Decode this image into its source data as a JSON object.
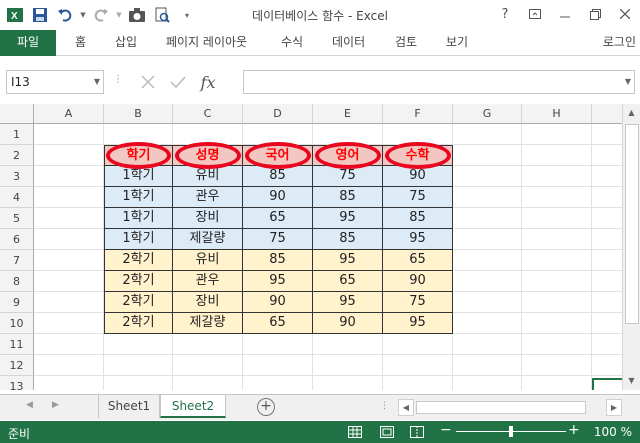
{
  "app": {
    "title": "데이터베이스 함수 - Excel",
    "accent": "#217346"
  },
  "window_controls": {
    "help": "?"
  },
  "qat_icons": [
    "excel-logo-icon",
    "save-icon",
    "undo-icon",
    "redo-icon",
    "camera-icon",
    "print-preview-icon",
    "customize-qat-icon"
  ],
  "ribbon": {
    "file": "파일",
    "tabs": [
      "홈",
      "삽입",
      "페이지 레이아웃",
      "수식",
      "데이터",
      "검토",
      "보기"
    ],
    "login": "로그인"
  },
  "formula_bar": {
    "name_box": "I13",
    "fx_label": "fx",
    "formula": ""
  },
  "grid": {
    "columns": [
      "A",
      "B",
      "C",
      "D",
      "E",
      "F",
      "G",
      "H"
    ],
    "rows": [
      "1",
      "2",
      "3",
      "4",
      "5",
      "6",
      "7",
      "8",
      "9",
      "10",
      "11",
      "12",
      "13"
    ],
    "headers": [
      "학기",
      "성명",
      "국어",
      "영어",
      "수학"
    ],
    "data": [
      [
        "1학기",
        "유비",
        "85",
        "75",
        "90"
      ],
      [
        "1학기",
        "관우",
        "90",
        "85",
        "75"
      ],
      [
        "1학기",
        "장비",
        "65",
        "95",
        "85"
      ],
      [
        "1학기",
        "제갈량",
        "75",
        "85",
        "95"
      ],
      [
        "2학기",
        "유비",
        "85",
        "95",
        "65"
      ],
      [
        "2학기",
        "관우",
        "95",
        "65",
        "90"
      ],
      [
        "2학기",
        "장비",
        "90",
        "95",
        "75"
      ],
      [
        "2학기",
        "제갈량",
        "65",
        "90",
        "95"
      ]
    ]
  },
  "sheets": {
    "tabs": [
      "Sheet1",
      "Sheet2"
    ],
    "active": "Sheet2"
  },
  "status": {
    "ready": "준비",
    "zoom": "100 %"
  }
}
